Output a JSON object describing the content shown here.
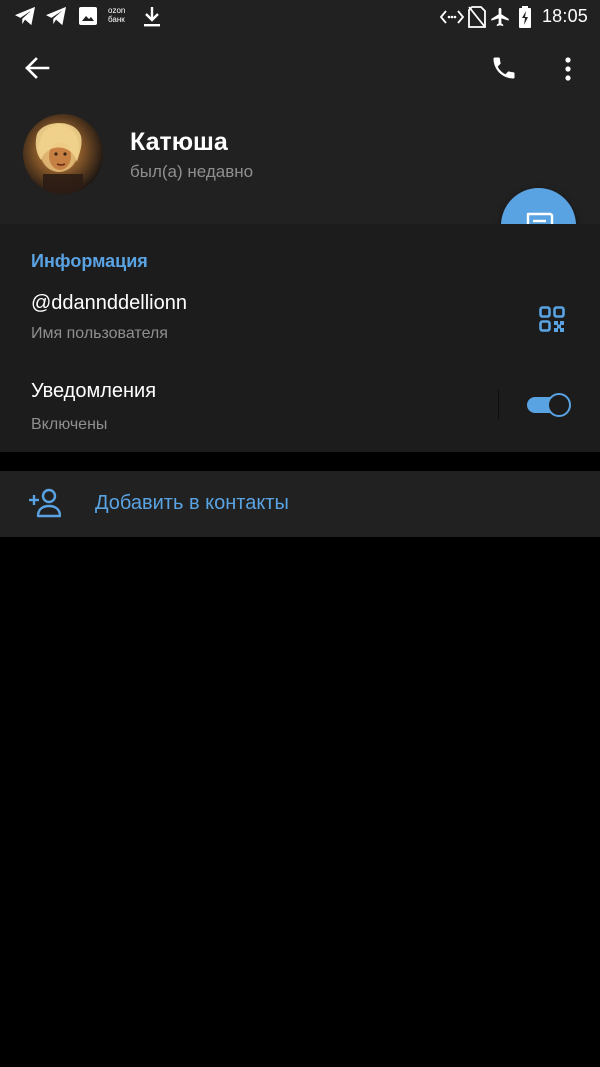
{
  "status_bar": {
    "time": "18:05",
    "bank_label_line1": "ozon",
    "bank_label_line2": "банк"
  },
  "profile": {
    "name": "Катюша",
    "last_seen": "был(а) недавно"
  },
  "info": {
    "section_title": "Информация",
    "username": "@ddannddellionn",
    "username_caption": "Имя пользователя",
    "notifications_label": "Уведомления",
    "notifications_state": "Включены",
    "notifications_enabled": true
  },
  "actions": {
    "add_contact_label": "Добавить в контакты"
  },
  "colors": {
    "accent": "#5aa3e3",
    "surface": "#212121",
    "surface_alt": "#1c1c1c",
    "background": "#000000",
    "secondary_text": "#8f8f8f"
  },
  "icons": [
    "telegram-icon",
    "image-icon",
    "download-icon",
    "code-icon",
    "no-sim-icon",
    "airplane-icon",
    "battery-icon",
    "back-arrow-icon",
    "phone-icon",
    "more-vert-icon",
    "message-icon",
    "qr-code-icon",
    "add-contact-icon"
  ]
}
